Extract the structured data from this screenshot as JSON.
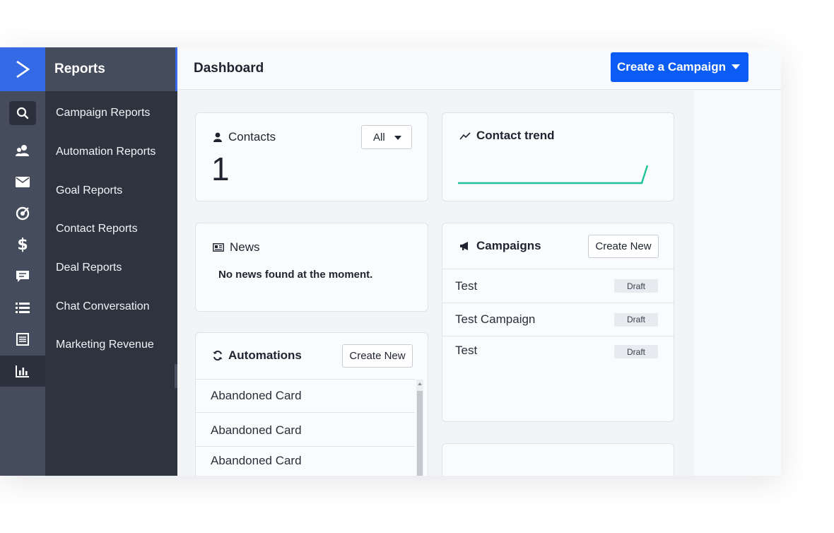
{
  "app": {
    "accent": "#356ae6",
    "cta_color": "#0b5cf5",
    "trend_color": "#1fc39a"
  },
  "rail": {
    "icons": [
      "logo-chevron-icon",
      "search-icon",
      "contacts-icon",
      "email-icon",
      "target-icon",
      "dollar-icon",
      "chat-icon",
      "list-icon",
      "document-icon",
      "bar-chart-icon"
    ]
  },
  "subnav": {
    "header": "Reports",
    "items": [
      {
        "label": "Campaign Reports"
      },
      {
        "label": "Automation Reports"
      },
      {
        "label": "Goal Reports"
      },
      {
        "label": "Contact Reports"
      },
      {
        "label": "Deal Reports"
      },
      {
        "label": "Chat Conversation"
      },
      {
        "label": "Marketing Revenue"
      }
    ]
  },
  "header": {
    "title": "Dashboard",
    "cta_label": "Create a Campaign"
  },
  "contacts_card": {
    "title": "Contacts",
    "filter_value": "All",
    "count": "1"
  },
  "trend_card": {
    "title": "Contact trend"
  },
  "news_card": {
    "title": "News",
    "empty_text": "No news found at the moment."
  },
  "campaigns_card": {
    "title": "Campaigns",
    "create_label": "Create New",
    "rows": [
      {
        "name": "Test",
        "status": "Draft"
      },
      {
        "name": "Test Campaign",
        "status": "Draft"
      },
      {
        "name": "Test",
        "status": "Draft"
      }
    ]
  },
  "automations_card": {
    "title": "Automations",
    "create_label": "Create New",
    "rows": [
      {
        "name": "Abandoned Card"
      },
      {
        "name": "Abandoned Card"
      },
      {
        "name": "Abandoned Card"
      }
    ]
  }
}
